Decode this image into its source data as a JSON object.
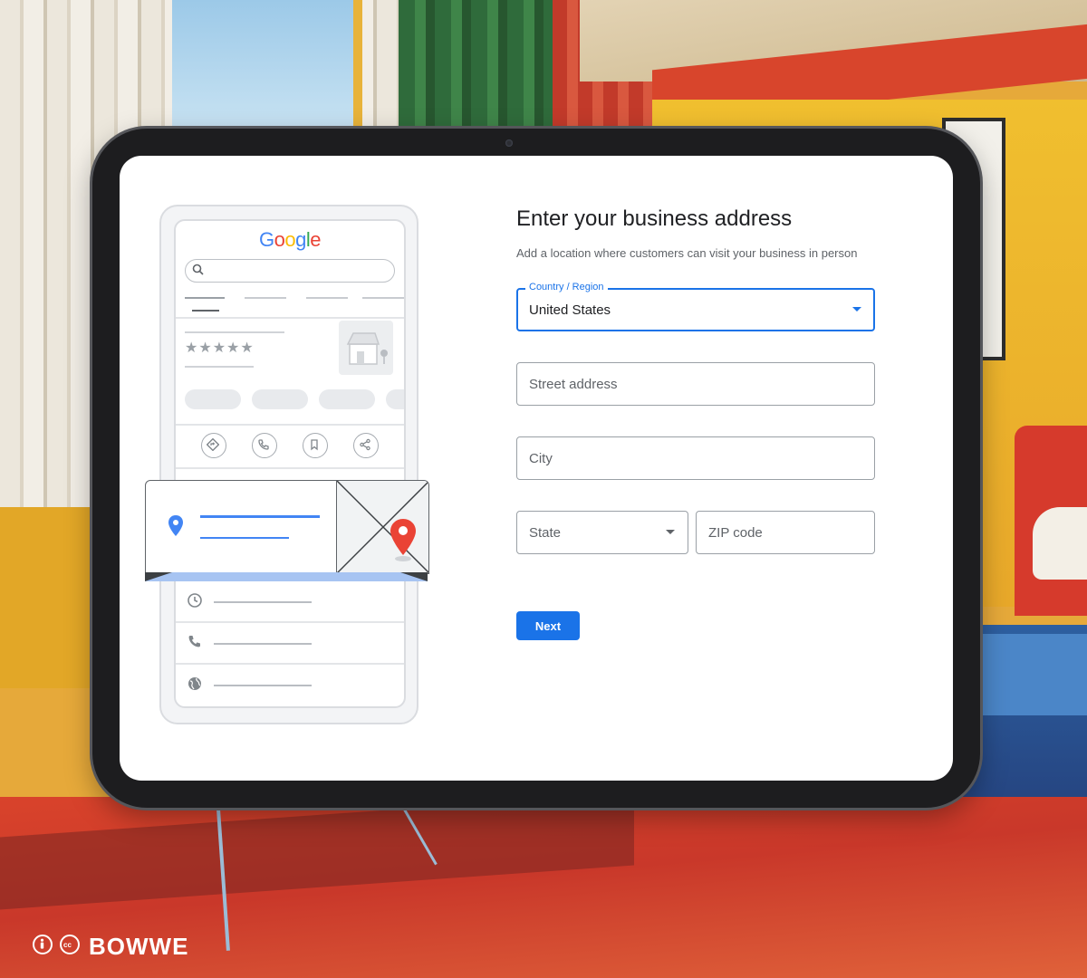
{
  "illustration": {
    "google_logo": "Google",
    "stars": "★★★★★"
  },
  "form": {
    "title": "Enter your business address",
    "subtitle": "Add a location where customers can visit your business in person",
    "country": {
      "label": "Country / Region",
      "value": "United States"
    },
    "street": {
      "placeholder": "Street address"
    },
    "city": {
      "placeholder": "City"
    },
    "state": {
      "placeholder": "State"
    },
    "zip": {
      "placeholder": "ZIP code"
    },
    "next_label": "Next"
  },
  "watermark": {
    "brand": "BOWWE"
  },
  "colors": {
    "accent": "#1a73e8",
    "map_pin": "#ea4335",
    "card_line": "#4285f4"
  },
  "icons": [
    "search-icon",
    "directions-icon",
    "phone-icon",
    "bookmark-icon",
    "share-icon",
    "location-pin-icon",
    "map-pin-icon",
    "clock-icon",
    "globe-icon",
    "chevron-down-icon",
    "attribution-icon",
    "cc-icon"
  ]
}
